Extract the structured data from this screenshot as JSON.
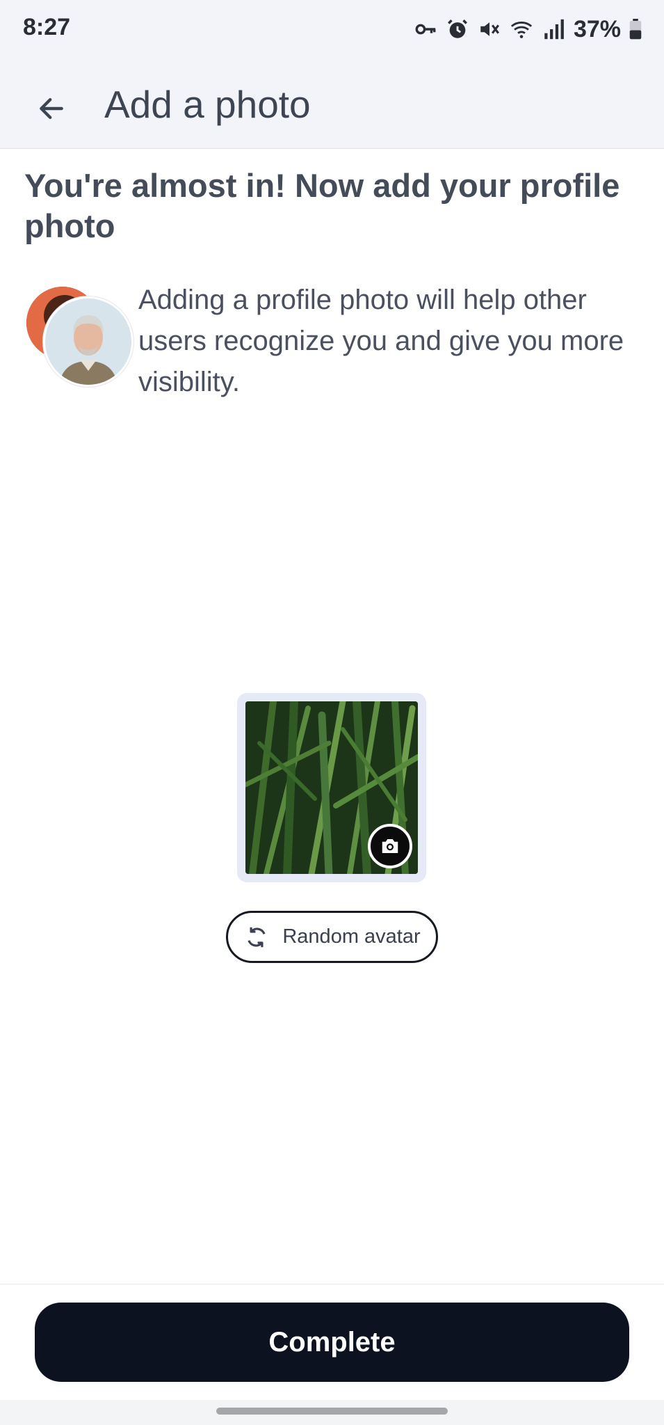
{
  "status_bar": {
    "time": "8:27",
    "battery": "37%",
    "icons": [
      "vpn-key-icon",
      "alarm-icon",
      "mute-icon",
      "wifi-icon",
      "signal-icon",
      "battery-icon"
    ]
  },
  "app_bar": {
    "title": "Add a photo",
    "back_icon": "back-arrow-icon"
  },
  "headline": "You're almost in! Now add your profile photo",
  "intro": {
    "text": "Adding a profile photo will help other users recognize you and give you more visibility."
  },
  "photo": {
    "camera_icon": "camera-icon"
  },
  "random_avatar": {
    "label": "Random avatar",
    "icon": "refresh-icon"
  },
  "complete": {
    "label": "Complete"
  },
  "colors": {
    "primary": "#0d1220",
    "bar_bg": "#f3f4f9",
    "text": "#3f4554"
  }
}
